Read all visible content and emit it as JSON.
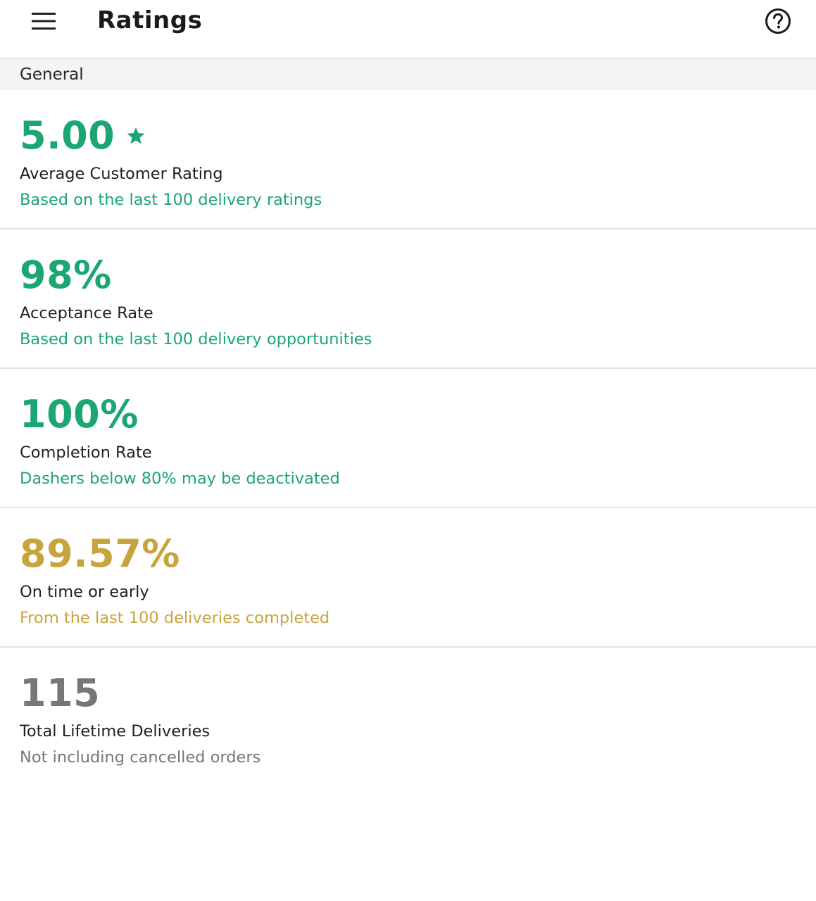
{
  "app_bar": {
    "title": "Ratings",
    "menu_icon": "hamburger-menu-icon",
    "help_icon": "help-circle-icon"
  },
  "section": {
    "title": "General"
  },
  "colors": {
    "green": "#1ba672",
    "gold": "#c9a43e",
    "gray": "#777777"
  },
  "metrics": [
    {
      "value": "5.00",
      "label": "Average Customer Rating",
      "sub": "Based on the last 100 delivery ratings",
      "color": "#1ba672",
      "icon": "star-icon"
    },
    {
      "value": "98%",
      "label": "Acceptance Rate",
      "sub": "Based on the last 100 delivery opportunities",
      "color": "#1ba672"
    },
    {
      "value": "100%",
      "label": "Completion Rate",
      "sub": "Dashers below 80% may be deactivated",
      "color": "#1ba672"
    },
    {
      "value": "89.57%",
      "label": "On time or early",
      "sub": "From the last 100 deliveries completed",
      "color": "#c9a43e"
    },
    {
      "value": "115",
      "label": "Total Lifetime Deliveries",
      "sub": "Not including cancelled orders",
      "color": "#777777"
    }
  ]
}
